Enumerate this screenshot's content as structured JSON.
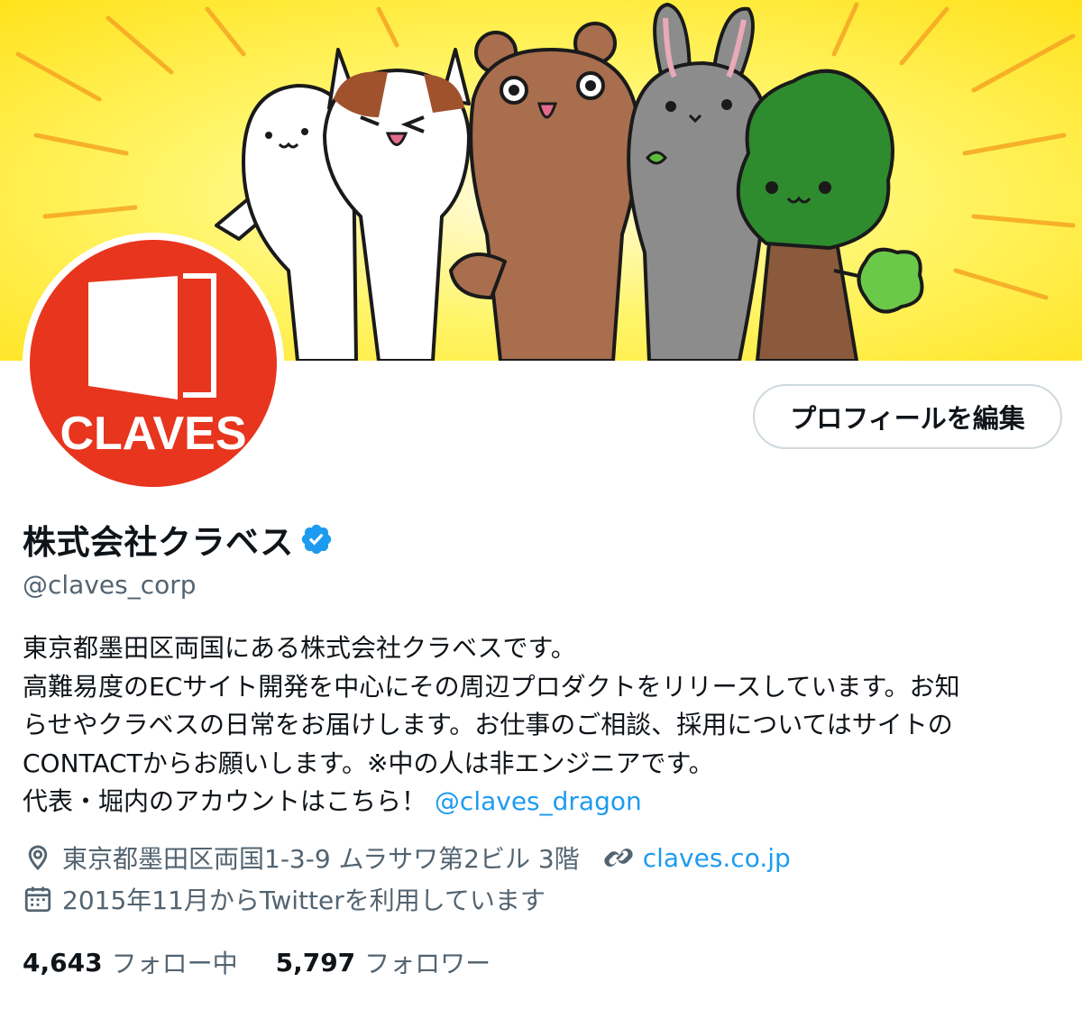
{
  "profile": {
    "display_name": "株式会社クラベス",
    "handle": "@claves_corp",
    "avatar_text": "CLAVES",
    "edit_label": "プロフィールを編集",
    "bio_lines": [
      "東京都墨田区両国にある株式会社クラベスです。",
      "高難易度のECサイト開発を中心にその周辺プロダクトをリリースしています。お知",
      "らせやクラベスの日常をお届けします。お仕事のご相談、採用についてはサイトの",
      "CONTACTからお願いします。※中の人は非エンジニアです。"
    ],
    "bio_last_prefix": "代表・堀内のアカウントはこちら！",
    "bio_mention": "@claves_dragon",
    "location": "東京都墨田区両国1-3-9 ムラサワ第2ビル 3階",
    "website": "claves.co.jp",
    "joined": "2015年11月からTwitterを利用しています",
    "following_count": "4,643",
    "following_label": "フォロー中",
    "followers_count": "5,797",
    "followers_label": "フォロワー"
  },
  "icons": {
    "verified": "verified-badge-icon",
    "location": "location-pin-icon",
    "link": "link-icon",
    "calendar": "calendar-icon"
  },
  "colors": {
    "brand_red": "#e8351e",
    "link_blue": "#1d9bf0",
    "secondary_text": "#536471",
    "banner_yellow": "#ffe93a"
  }
}
